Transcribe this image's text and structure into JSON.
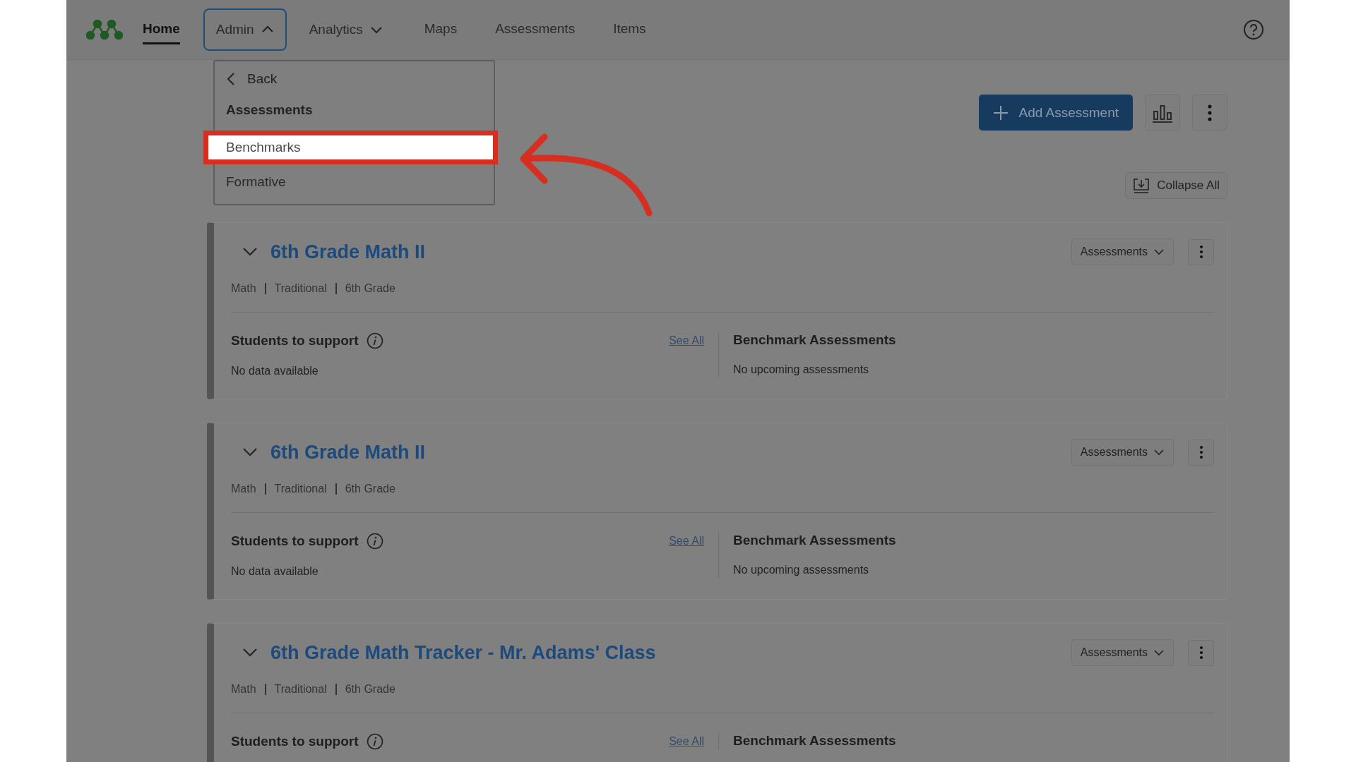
{
  "nav": {
    "items": [
      {
        "label": "Home",
        "kind": "link",
        "selected": true
      },
      {
        "label": "Admin",
        "kind": "dropdown",
        "selected": false,
        "expanded": true
      },
      {
        "label": "Analytics",
        "kind": "dropdown",
        "selected": false,
        "expanded": false
      },
      {
        "label": "Maps",
        "kind": "link",
        "selected": false
      },
      {
        "label": "Assessments",
        "kind": "link",
        "selected": false
      },
      {
        "label": "Items",
        "kind": "link",
        "selected": false
      }
    ]
  },
  "menu": {
    "back": "Back",
    "items": [
      {
        "label": "Assessments",
        "kind": "header"
      },
      {
        "label": "Benchmarks",
        "kind": "item",
        "highlighted": true
      },
      {
        "label": "Formative",
        "kind": "item",
        "highlighted": false
      }
    ]
  },
  "toolbar": {
    "add_button": "Add Assessment",
    "collapse_button": "Collapse All"
  },
  "cards": [
    {
      "title": "6th Grade Math II",
      "expanded": true,
      "meta": [
        "Math",
        "Traditional",
        "6th Grade"
      ],
      "dropdown": "Assessments",
      "students_title": "Students to support",
      "see_all": "See All",
      "students_text": "No data available",
      "benchmark_title": "Benchmark Assessments",
      "benchmark_text": "No upcoming assessments"
    },
    {
      "title": "6th Grade Math II",
      "expanded": true,
      "meta": [
        "Math",
        "Traditional",
        "6th Grade"
      ],
      "dropdown": "Assessments",
      "students_title": "Students to support",
      "see_all": "See All",
      "students_text": "No data available",
      "benchmark_title": "Benchmark Assessments",
      "benchmark_text": "No upcoming assessments"
    },
    {
      "title": "6th Grade Math Tracker - Mr. Adams' Class",
      "expanded": true,
      "meta": [
        "Math",
        "Traditional",
        "6th Grade"
      ],
      "dropdown": "Assessments",
      "students_title": "Students to support",
      "see_all": "See All",
      "benchmark_title": "Benchmark Assessments"
    }
  ]
}
